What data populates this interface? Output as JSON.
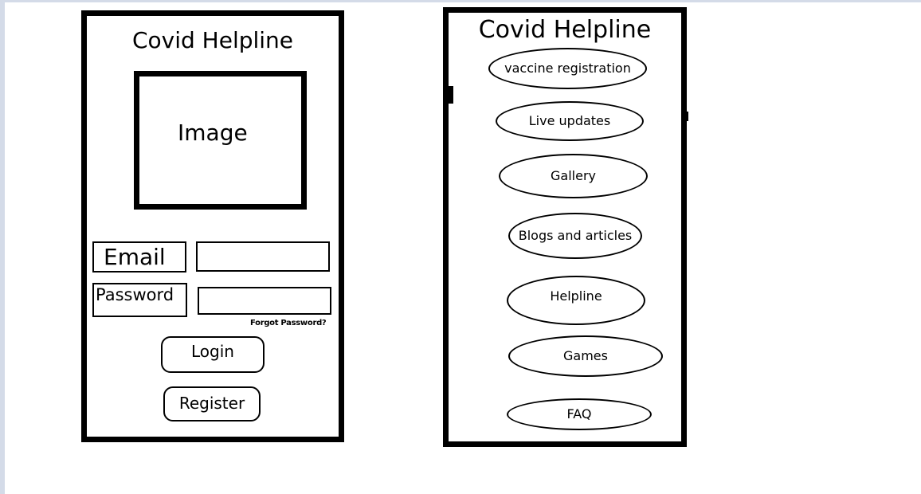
{
  "login_screen": {
    "title": "Covid Helpline",
    "image_placeholder": "Image",
    "email_label": "Email",
    "email_value": "",
    "password_label": "Password",
    "password_value": "",
    "forgot_password": "Forgot Password?",
    "login_button": "Login",
    "register_button": "Register"
  },
  "menu_screen": {
    "title": "Covid Helpline",
    "items": [
      {
        "label": "vaccine registration"
      },
      {
        "label": "Live updates"
      },
      {
        "label": "Gallery"
      },
      {
        "label": "Blogs and articles"
      },
      {
        "label": "Helpline"
      },
      {
        "label": "Games"
      },
      {
        "label": "FAQ"
      }
    ]
  }
}
